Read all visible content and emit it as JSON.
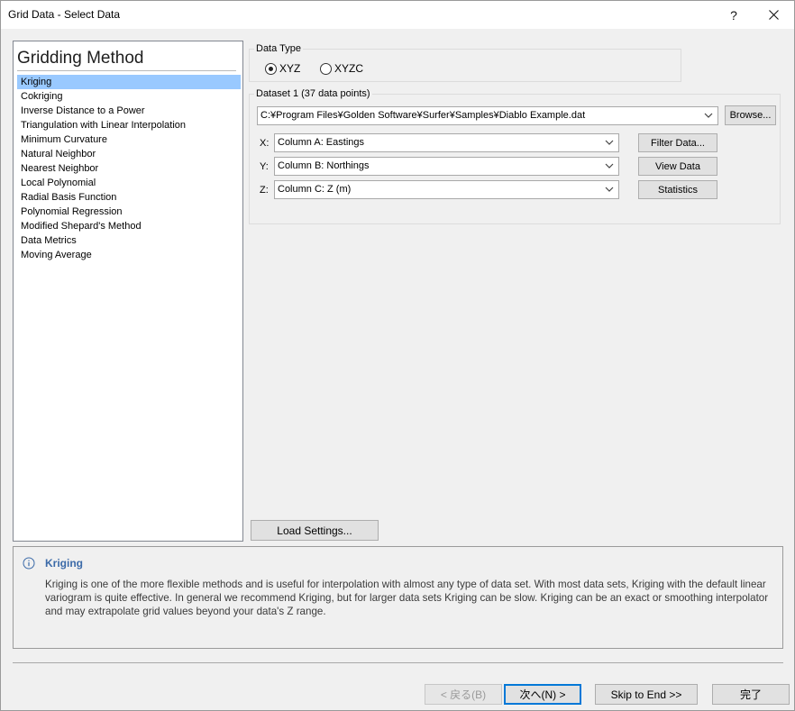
{
  "window": {
    "title": "Grid Data - Select Data",
    "help_label": "?"
  },
  "gridding": {
    "heading": "Gridding Method",
    "selected_index": 0,
    "methods": [
      "Kriging",
      "Cokriging",
      "Inverse Distance to a Power",
      "Triangulation with Linear Interpolation",
      "Minimum Curvature",
      "Natural Neighbor",
      "Nearest Neighbor",
      "Local Polynomial",
      "Radial Basis Function",
      "Polynomial Regression",
      "Modified Shepard's Method",
      "Data Metrics",
      "Moving Average"
    ]
  },
  "data_type": {
    "label": "Data Type",
    "options": [
      {
        "label": "XYZ",
        "checked": true
      },
      {
        "label": "XYZC",
        "checked": false
      }
    ]
  },
  "dataset": {
    "label": "Dataset 1   (37 data points)",
    "file_path": "C:¥Program Files¥Golden Software¥Surfer¥Samples¥Diablo Example.dat",
    "browse_label": "Browse...",
    "x_label": "X:",
    "y_label": "Y:",
    "z_label": "Z:",
    "x_column": "Column A:  Eastings",
    "y_column": "Column B:  Northings",
    "z_column": "Column C:  Z (m)",
    "filter_label": "Filter Data...",
    "view_label": "View Data",
    "stats_label": "Statistics"
  },
  "load_settings_label": "Load Settings...",
  "description": {
    "title": "Kriging",
    "body": "Kriging is one of the more flexible methods and is useful for interpolation with almost any type of data set. With most data sets, Kriging with the default linear variogram is quite effective. In general we recommend Kriging, but for larger data sets Kriging can be slow. Kriging can be an exact or smoothing interpolator and may extrapolate grid values beyond your data's Z range."
  },
  "footer": {
    "back_label": "< 戻る(B)",
    "next_label": "次へ(N) >",
    "skip_label": "Skip to End >>",
    "finish_label": "完了"
  },
  "colors": {
    "selection": "#99c9ff",
    "accent": "#0078d7",
    "desc_title": "#3b6aa8"
  },
  "icons": [
    "close-icon",
    "chevron-down-icon",
    "info-icon"
  ]
}
